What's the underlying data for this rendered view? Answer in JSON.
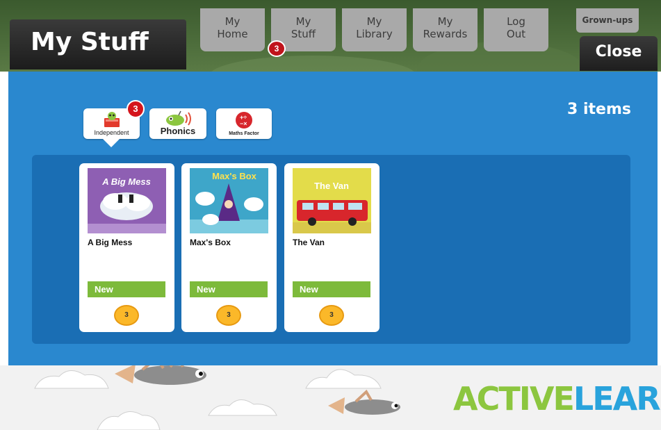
{
  "header": {
    "title": "My Stuff",
    "nav": [
      {
        "line1": "My",
        "line2": "Home"
      },
      {
        "line1": "My",
        "line2": "Stuff"
      },
      {
        "line1": "My",
        "line2": "Library"
      },
      {
        "line1": "My",
        "line2": "Rewards"
      },
      {
        "line1": "Log",
        "line2": "Out"
      }
    ],
    "stuff_badge": "3",
    "grownups_label": "Grown-ups",
    "close_label": "Close"
  },
  "main": {
    "item_count": "3 items",
    "tabs": [
      {
        "label": "Independent",
        "badge": "3",
        "icon": "book-icon"
      },
      {
        "label": "Phonics",
        "icon": "bug-icon"
      },
      {
        "label": "Maths Factor",
        "icon": "maths-icon"
      }
    ],
    "books": [
      {
        "title": "A Big Mess",
        "cover_title": "A Big Mess",
        "status": "New",
        "coins": "3",
        "cover_color": "#8e5fb3"
      },
      {
        "title": "Max's Box",
        "cover_title": "Max's Box",
        "status": "New",
        "coins": "3",
        "cover_color": "#3ea6c9"
      },
      {
        "title": "The Van",
        "cover_title": "The Van",
        "status": "New",
        "coins": "3",
        "cover_color": "#e3dc4a"
      }
    ]
  },
  "footer": {
    "logo_text": "ACTIVELEARN"
  },
  "colors": {
    "panel_blue": "#2a88cf",
    "shelf_blue": "#1a6eb4",
    "new_green": "#7dba3b",
    "coin_gold": "#fbb829",
    "badge_red": "#d4141c"
  }
}
